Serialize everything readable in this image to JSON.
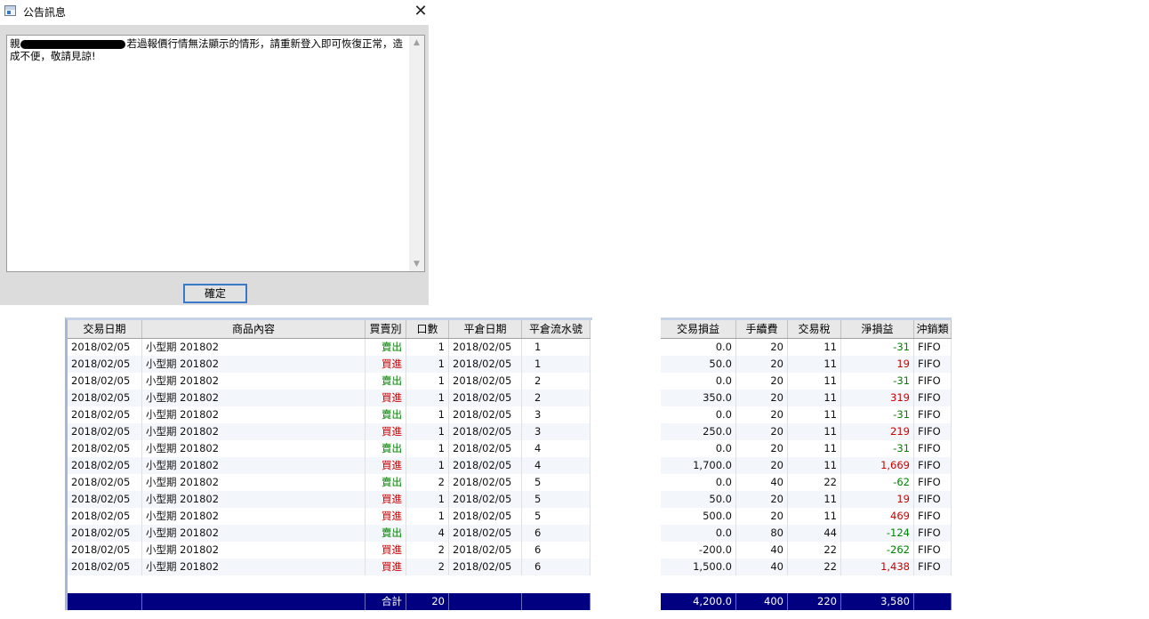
{
  "dialog": {
    "title": "公告訊息",
    "message_prefix": "親",
    "message": "若過報價行情無法顯示的情形，請重新登入即可恢復正常，造成不便，敬請見諒!",
    "ok_label": "確定"
  },
  "left_table": {
    "headers": [
      "交易日期",
      "商品內容",
      "買賣別",
      "口數",
      "平倉日期",
      "平倉流水號"
    ],
    "rows": [
      [
        "2018/02/05",
        "小型期 201802",
        "賣出",
        "1",
        "2018/02/05",
        "1"
      ],
      [
        "2018/02/05",
        "小型期 201802",
        "買進",
        "1",
        "2018/02/05",
        "1"
      ],
      [
        "2018/02/05",
        "小型期 201802",
        "賣出",
        "1",
        "2018/02/05",
        "2"
      ],
      [
        "2018/02/05",
        "小型期 201802",
        "買進",
        "1",
        "2018/02/05",
        "2"
      ],
      [
        "2018/02/05",
        "小型期 201802",
        "賣出",
        "1",
        "2018/02/05",
        "3"
      ],
      [
        "2018/02/05",
        "小型期 201802",
        "買進",
        "1",
        "2018/02/05",
        "3"
      ],
      [
        "2018/02/05",
        "小型期 201802",
        "賣出",
        "1",
        "2018/02/05",
        "4"
      ],
      [
        "2018/02/05",
        "小型期 201802",
        "買進",
        "1",
        "2018/02/05",
        "4"
      ],
      [
        "2018/02/05",
        "小型期 201802",
        "賣出",
        "2",
        "2018/02/05",
        "5"
      ],
      [
        "2018/02/05",
        "小型期 201802",
        "買進",
        "1",
        "2018/02/05",
        "5"
      ],
      [
        "2018/02/05",
        "小型期 201802",
        "買進",
        "1",
        "2018/02/05",
        "5"
      ],
      [
        "2018/02/05",
        "小型期 201802",
        "賣出",
        "4",
        "2018/02/05",
        "6"
      ],
      [
        "2018/02/05",
        "小型期 201802",
        "買進",
        "2",
        "2018/02/05",
        "6"
      ],
      [
        "2018/02/05",
        "小型期 201802",
        "買進",
        "2",
        "2018/02/05",
        "6"
      ]
    ],
    "total_label": "合計",
    "total_qty": "20"
  },
  "right_table": {
    "headers": [
      "交易損益",
      "手續費",
      "交易稅",
      "淨損益",
      "沖銷類"
    ],
    "rows": [
      [
        "0.0",
        "20",
        "11",
        "-31",
        "FIFO"
      ],
      [
        "50.0",
        "20",
        "11",
        "19",
        "FIFO"
      ],
      [
        "0.0",
        "20",
        "11",
        "-31",
        "FIFO"
      ],
      [
        "350.0",
        "20",
        "11",
        "319",
        "FIFO"
      ],
      [
        "0.0",
        "20",
        "11",
        "-31",
        "FIFO"
      ],
      [
        "250.0",
        "20",
        "11",
        "219",
        "FIFO"
      ],
      [
        "0.0",
        "20",
        "11",
        "-31",
        "FIFO"
      ],
      [
        "1,700.0",
        "20",
        "11",
        "1,669",
        "FIFO"
      ],
      [
        "0.0",
        "40",
        "22",
        "-62",
        "FIFO"
      ],
      [
        "50.0",
        "20",
        "11",
        "19",
        "FIFO"
      ],
      [
        "500.0",
        "20",
        "11",
        "469",
        "FIFO"
      ],
      [
        "0.0",
        "80",
        "44",
        "-124",
        "FIFO"
      ],
      [
        "-200.0",
        "40",
        "22",
        "-262",
        "FIFO"
      ],
      [
        "1,500.0",
        "40",
        "22",
        "1,438",
        "FIFO"
      ]
    ],
    "totals": [
      "4,200.0",
      "400",
      "220",
      "3,580",
      ""
    ]
  },
  "colors": {
    "sell": "#008000",
    "buy": "#cc0000",
    "total_bar": "#000080"
  }
}
